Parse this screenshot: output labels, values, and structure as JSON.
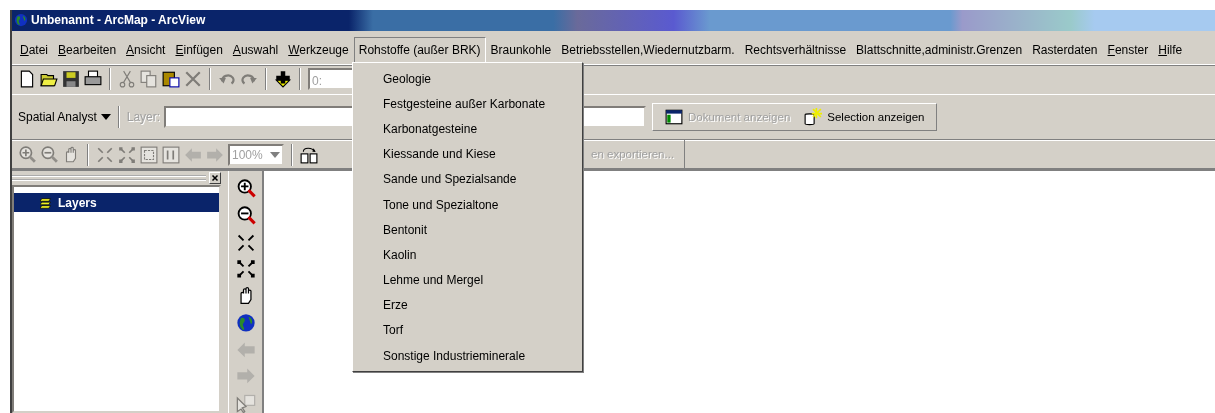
{
  "window": {
    "title": "Unbenannt - ArcMap - ArcView"
  },
  "menu_bar": [
    {
      "label": "Datei",
      "mnemonic": true,
      "selected": false
    },
    {
      "label": "Bearbeiten",
      "mnemonic": true,
      "selected": false
    },
    {
      "label": "Ansicht",
      "mnemonic": true,
      "selected": false
    },
    {
      "label": "Einfügen",
      "mnemonic": true,
      "selected": false
    },
    {
      "label": "Auswahl",
      "mnemonic": true,
      "selected": false
    },
    {
      "label": "Werkzeuge",
      "mnemonic": true,
      "selected": false
    },
    {
      "label": "Rohstoffe (außer BRK)",
      "mnemonic": false,
      "selected": true
    },
    {
      "label": "Braunkohle",
      "mnemonic": false,
      "selected": false
    },
    {
      "label": "Betriebsstellen,Wiedernutzbarm.",
      "mnemonic": false,
      "selected": false
    },
    {
      "label": "Rechtsverhältnisse",
      "mnemonic": false,
      "selected": false
    },
    {
      "label": "Blattschnitte,administr.Grenzen",
      "mnemonic": false,
      "selected": false
    },
    {
      "label": "Rasterdaten",
      "mnemonic": false,
      "selected": false
    },
    {
      "label": "Fenster",
      "mnemonic": true,
      "selected": false
    },
    {
      "label": "Hilfe",
      "mnemonic": true,
      "selected": false
    }
  ],
  "dropdown_menu": [
    "Geologie",
    "Festgesteine außer Karbonate",
    "Karbonatgesteine",
    "Kiessande und Kiese",
    "Sande und Spezialsande",
    "Tone und Spezialtone",
    "Bentonit",
    "Kaolin",
    "Lehme und Mergel",
    "Erze",
    "Torf",
    "Sonstige Industrieminerale"
  ],
  "standard_toolbar": {
    "buttons": [
      {
        "disabled": false
      },
      {
        "disabled": false
      },
      {
        "disabled": false
      },
      {
        "disabled": false
      },
      {
        "disabled": true
      },
      {
        "disabled": true
      },
      {
        "disabled": false
      },
      {
        "disabled": true
      },
      {
        "disabled": true
      },
      {
        "disabled": true
      },
      {
        "disabled": false
      }
    ],
    "scale_field": {
      "value": "0:"
    }
  },
  "spatial_analyst_toolbar": {
    "menu": {
      "label": "Spatial Analyst"
    },
    "layer_label": {
      "text": "Layer:",
      "disabled": true
    }
  },
  "document_toolbar": [
    {
      "label": "Dokument anzeigen",
      "disabled": true
    },
    {
      "label": "Selection anzeigen",
      "disabled": false
    }
  ],
  "layout_toolbar": {
    "buttons": [
      {
        "disabled": true
      },
      {
        "disabled": true
      },
      {
        "disabled": true
      },
      {
        "disabled": true
      },
      {
        "disabled": true
      },
      {
        "disabled": true
      },
      {
        "disabled": true
      },
      {
        "disabled": true
      },
      {
        "disabled": true
      }
    ],
    "zoom_combo": {
      "value": "100%",
      "disabled": true
    },
    "change_layout": {
      "disabled": false
    },
    "export_button": {
      "label": "en exportieren...",
      "disabled": true
    }
  },
  "table_of_contents": {
    "items": [
      {
        "label": "Layers",
        "selected": true
      }
    ]
  },
  "tools_toolbar": {
    "buttons": [
      {
        "disabled": false
      },
      {
        "disabled": false
      },
      {
        "disabled": false
      },
      {
        "disabled": false
      },
      {
        "disabled": false
      },
      {
        "disabled": false
      },
      {
        "disabled": true
      },
      {
        "disabled": true
      },
      {
        "disabled": true
      }
    ]
  }
}
